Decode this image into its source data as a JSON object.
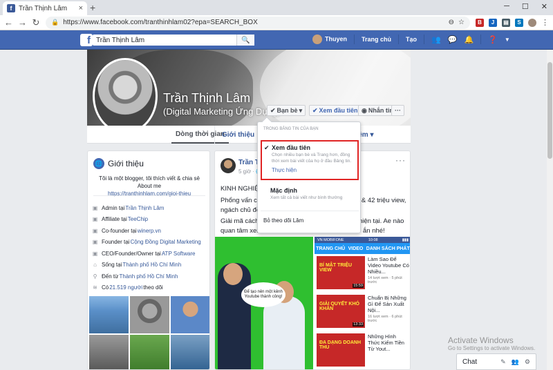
{
  "browser": {
    "tab_title": "Trần Thịnh Lâm",
    "tab_close": "×",
    "new_tab": "+",
    "url": "https://www.facebook.com/tranthinhlam02?epa=SEARCH_BOX",
    "window_controls": [
      "─",
      "☐",
      "✕"
    ]
  },
  "fb_header": {
    "logo": "f",
    "search_value": "Trần Thịnh Lâm",
    "user_name": "Thuyen",
    "home": "Trang chủ",
    "create": "Tạo"
  },
  "profile": {
    "name": "Trần Thịnh Lâm",
    "subtitle": "(Digital Marketing Ứng Dụng)",
    "friends_btn": "Bạn bè",
    "see_first_btn": "Xem đầu tiên",
    "message_btn": "Nhắn tin",
    "more_btn": "···"
  },
  "tabs": {
    "timeline": "Dòng thời gian",
    "about": "Giới thiệu",
    "more": "Thêm"
  },
  "intro": {
    "title": "Giới thiệu",
    "bio_line1": "Tôi là một blogger, tôi thích viết & chia sẻ  About me",
    "bio_link": "https://tranthinhlam.com/gioi-thieu",
    "items": [
      {
        "text": "Admin tại ",
        "link": "Trần Thịnh Lâm",
        "icon": "briefcase-icon"
      },
      {
        "text": "Affiliate tại ",
        "link": "TeeChip",
        "icon": "briefcase-icon"
      },
      {
        "text": "Co-founder tại ",
        "link": "winerp.vn",
        "icon": "briefcase-icon"
      },
      {
        "text": "Founder tại ",
        "link": "Cộng Đồng Digital Marketing",
        "icon": "briefcase-icon"
      },
      {
        "text": "CEO/Founder/Owner tại ",
        "link": "ATP Software",
        "icon": "briefcase-icon"
      },
      {
        "text": "Sống tại ",
        "link": "Thành phố Hồ Chí Minh",
        "icon": "home-icon"
      },
      {
        "text": "Đến từ ",
        "link": "Thành phố Hồ Chí Minh",
        "icon": "location-icon"
      },
      {
        "text": "Có ",
        "link": "21.519 người",
        "suffix": " theo dõi",
        "icon": "followers-icon"
      }
    ]
  },
  "post": {
    "author": "Trần Thị",
    "time": "5 giờ ·",
    "more": "···",
    "line1": "KINH NGHIỆM X",
    "line2a": "Phổng vấn cậu e",
    "line2b": "b & 42 triệu view,",
    "line3": "ngách chủ đề kế",
    "line4a": "Giải mã cách thứ",
    "line4b": "hư thực hiện tại. Ae nào",
    "line5a": "quan tâm xem ca",
    "line5b": "ắn nhé!",
    "bubble": "Để tạo nên một kênh Youtube thành công!"
  },
  "phone": {
    "carrier": "VN MOBIFONE",
    "time": "10:08",
    "nav": [
      "TRANG CHỦ",
      "VIDEO",
      "DANH SÁCH PHÁT"
    ],
    "videos": [
      {
        "thumb": "BÍ MẬT TRIỆU VIEW",
        "duration": "15:59",
        "title": "Làm Sao Để Video Youtube Có Nhiều...",
        "meta": "14 lượt xem · 5 phút trước"
      },
      {
        "thumb": "GIẢI QUYẾT KHÓ KHĂN",
        "duration": "13:33",
        "title": "Chuẩn Bị Những Gì Để Sản Xuất Nội...",
        "meta": "16 lượt xem · 6 phút trước"
      },
      {
        "thumb": "ĐA DẠNG DOANH THU",
        "duration": "",
        "title": "Những Hình Thức Kiếm Tiền Từ Yout...",
        "meta": ""
      }
    ]
  },
  "dropdown": {
    "header": "TRONG BẢNG TIN CỦA BẠN",
    "opt1_title": "Xem đầu tiên",
    "opt1_desc": "Chọn nhiều bạn bè và Trang hơn, đồng thời xem bài viết của họ ở đầu Bảng tin.",
    "opt1_link": "Thực hiện",
    "opt2_title": "Mặc định",
    "opt2_desc": "Xem tất cả bài viết như bình thường",
    "unfollow": "Bỏ theo dõi Lâm"
  },
  "windows": {
    "line1": "Activate Windows",
    "line2": "Go to Settings to activate Windows."
  },
  "chat": {
    "label": "Chat"
  },
  "colors": {
    "fb_blue": "#4267b2",
    "link": "#365899",
    "highlight_border": "#e02424"
  }
}
